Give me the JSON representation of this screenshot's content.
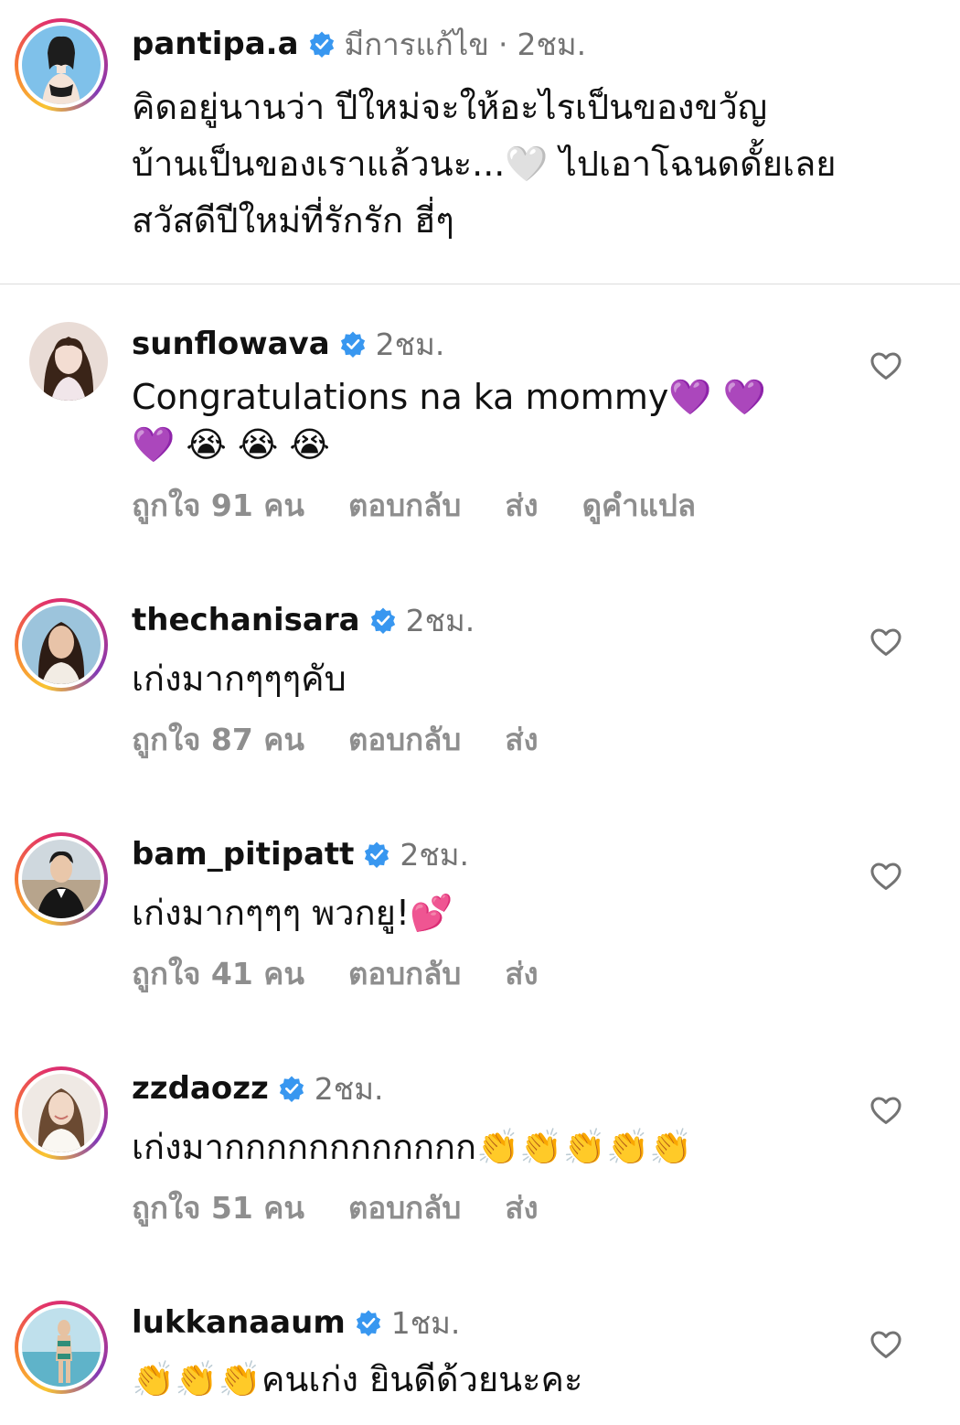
{
  "caption": {
    "username": "pantipa.a",
    "edited": "มีการแก้ไข",
    "separator": "·",
    "time": "2ชม.",
    "lines": [
      "คิดอยู่นานว่า ปีใหม่จะให้อะไรเป็นของขวัญ",
      "บ้านเป็นของเราแล้วนะ...🤍 ไปเอาโฉนดดั้ยเลย",
      "สวัสดีปีใหม่ที่รักรัก ฮี่ๆ"
    ]
  },
  "comments": [
    {
      "username": "sunflowava",
      "time": "2ชม.",
      "text_line1": "Congratulations na ka mommy💜 💜",
      "text_line2": "💜 😭 😭 😭",
      "likes": "ถูกใจ 91 คน",
      "reply": "ตอบกลับ",
      "send": "ส่ง",
      "translate": "ดูคำแปล"
    },
    {
      "username": "thechanisara",
      "time": "2ชม.",
      "text_line1": "เก่งมากๆๆๆคับ",
      "likes": "ถูกใจ 87 คน",
      "reply": "ตอบกลับ",
      "send": "ส่ง"
    },
    {
      "username": "bam_pitipatt",
      "time": "2ชม.",
      "text_line1": "เก่งมากๆๆๆ พวกยู!💕",
      "likes": "ถูกใจ 41 คน",
      "reply": "ตอบกลับ",
      "send": "ส่ง"
    },
    {
      "username": "zzdaozz",
      "time": "2ชม.",
      "text_line1": "เก่งมากกกกกกกกกกกก👏👏👏👏👏",
      "likes": "ถูกใจ 51 คน",
      "reply": "ตอบกลับ",
      "send": "ส่ง"
    },
    {
      "username": "lukkanaaum",
      "time": "1ชม.",
      "text_line1": "👏👏👏คนเก่ง ยินดีด้วยนะคะ"
    }
  ],
  "colors": {
    "verified": "#3897f0",
    "meta_gray": "#737373",
    "action_gray": "#8e8e8e",
    "purple_heart": "#9b3bea"
  },
  "icons": {
    "verified": "verified-badge-icon",
    "like": "heart-outline-icon"
  }
}
